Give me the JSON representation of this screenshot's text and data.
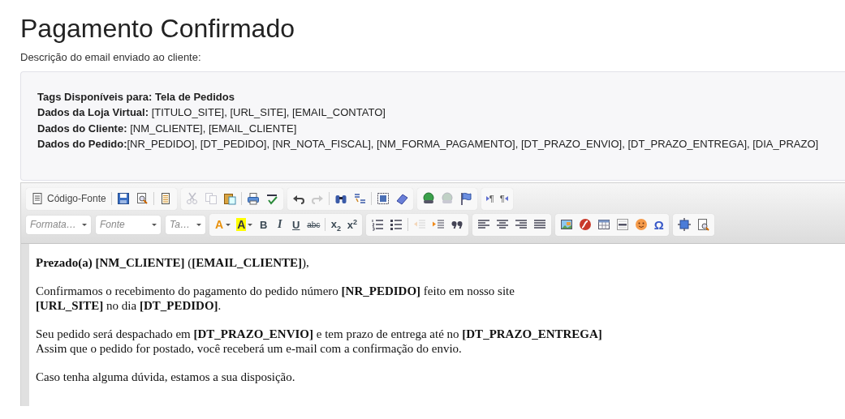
{
  "page": {
    "title": "Pagamento Confirmado",
    "description": "Descrição do email enviado ao cliente:"
  },
  "tags_box": {
    "lines": [
      {
        "kind": "heading",
        "text": "Tags Disponíveis para: Tela de Pedidos"
      },
      {
        "kind": "line",
        "text": "**Dados da Loja Virtual:** [TITULO_SITE], [URL_SITE], [EMAIL_CONTATO]"
      },
      {
        "kind": "line",
        "text": "**Dados do Cliente:** [NM_CLIENTE], [EMAIL_CLIENTE]"
      },
      {
        "kind": "line",
        "text": "**Dados do Pedido:**[NR_PEDIDO], [DT_PEDIDO], [NR_NOTA_FISCAL], [NM_FORMA_PAGAMENTO], [DT_PRAZO_ENVIO], [DT_PRAZO_ENTREGA], [DIA_PRAZO]"
      }
    ]
  },
  "editor": {
    "toolbar_rows": [
      [
        [
          {
            "kind": "source",
            "text": "Código-Fonte",
            "disabled": false
          },
          {
            "kind": "sep"
          },
          {
            "kind": "save",
            "disabled": false
          },
          {
            "kind": "preview",
            "disabled": false
          },
          {
            "kind": "sep"
          },
          {
            "kind": "templates",
            "disabled": false
          }
        ],
        [
          {
            "kind": "cut",
            "disabled": true
          },
          {
            "kind": "copy",
            "disabled": true
          },
          {
            "kind": "paste",
            "disabled": false
          },
          {
            "kind": "sep"
          },
          {
            "kind": "print",
            "disabled": false
          },
          {
            "kind": "spell",
            "disabled": false
          }
        ],
        [
          {
            "kind": "undo",
            "disabled": false
          },
          {
            "kind": "redo",
            "disabled": true
          },
          {
            "kind": "sep"
          },
          {
            "kind": "find",
            "disabled": false
          },
          {
            "kind": "replace",
            "disabled": false
          },
          {
            "kind": "sep"
          },
          {
            "kind": "selectall",
            "disabled": false
          },
          {
            "kind": "eraser",
            "disabled": false
          }
        ],
        [
          {
            "kind": "link",
            "disabled": false
          },
          {
            "kind": "unlink",
            "disabled": true
          },
          {
            "kind": "flag",
            "disabled": false
          }
        ],
        [
          {
            "kind": "ltr",
            "text": "¶",
            "disabled": false
          },
          {
            "kind": "rtl",
            "text": "¶",
            "disabled": false
          }
        ]
      ],
      [
        [
          {
            "kind": "dropdown",
            "placeholder": "Formata…"
          },
          {
            "kind": "dropdown",
            "placeholder": "Fonte"
          },
          {
            "kind": "dropdown",
            "placeholder": "Ta…"
          }
        ],
        [
          {
            "kind": "textcolor",
            "text": "A",
            "disabled": false
          },
          {
            "kind": "bgcolor",
            "text": "A",
            "disabled": false
          },
          {
            "kind": "bold",
            "text": "B",
            "disabled": false
          },
          {
            "kind": "italic",
            "text": "I",
            "disabled": false
          },
          {
            "kind": "underline",
            "text": "U",
            "disabled": false
          },
          {
            "kind": "strike",
            "text": "abc",
            "disabled": false
          },
          {
            "kind": "sep"
          },
          {
            "kind": "subscript",
            "text": "x$_{2}$",
            "disabled": false
          },
          {
            "kind": "superscript",
            "text": "x$^{2}$",
            "disabled": false
          }
        ],
        [
          {
            "kind": "ol",
            "disabled": false
          },
          {
            "kind": "ul",
            "disabled": false
          },
          {
            "kind": "sep"
          },
          {
            "kind": "outdent",
            "disabled": true
          },
          {
            "kind": "indent",
            "disabled": false
          },
          {
            "kind": "quote",
            "disabled": false
          }
        ],
        [
          {
            "kind": "alignleft",
            "disabled": false
          },
          {
            "kind": "aligncenter",
            "disabled": false
          },
          {
            "kind": "alignright",
            "disabled": false
          },
          {
            "kind": "justify",
            "disabled": false
          }
        ],
        [
          {
            "kind": "image",
            "disabled": false
          },
          {
            "kind": "flash",
            "disabled": false
          },
          {
            "kind": "table",
            "disabled": false
          },
          {
            "kind": "hr",
            "disabled": false
          },
          {
            "kind": "smiley",
            "disabled": false
          },
          {
            "kind": "omega",
            "text": "Ω",
            "disabled": false
          }
        ],
        [
          {
            "kind": "maximize",
            "disabled": false
          },
          {
            "kind": "showblocks",
            "disabled": false
          }
        ]
      ]
    ],
    "content": [
      {
        "lines": [
          "**Prezado(a) [NM_CLIENTE]** (**[EMAIL_CLIENTE]**),"
        ]
      },
      {
        "lines": [
          "Confirmamos o recebimento do pagamento do pedido número **[NR_PEDIDO]** feito em nosso site",
          "**[URL_SITE]** no dia **[DT_PEDIDO]**."
        ]
      },
      {
        "lines": [
          "Seu pedido será despachado em **[DT_PRAZO_ENVIO]** e tem prazo de entrega até no **[DT_PRAZO_ENTREGA]**",
          "Assim que o pedido for postado, você receberá um e-mail com a confirmação do envio."
        ]
      },
      {
        "lines": [
          "Caso tenha alguma dúvida, estamos a sua disposição."
        ]
      }
    ]
  }
}
